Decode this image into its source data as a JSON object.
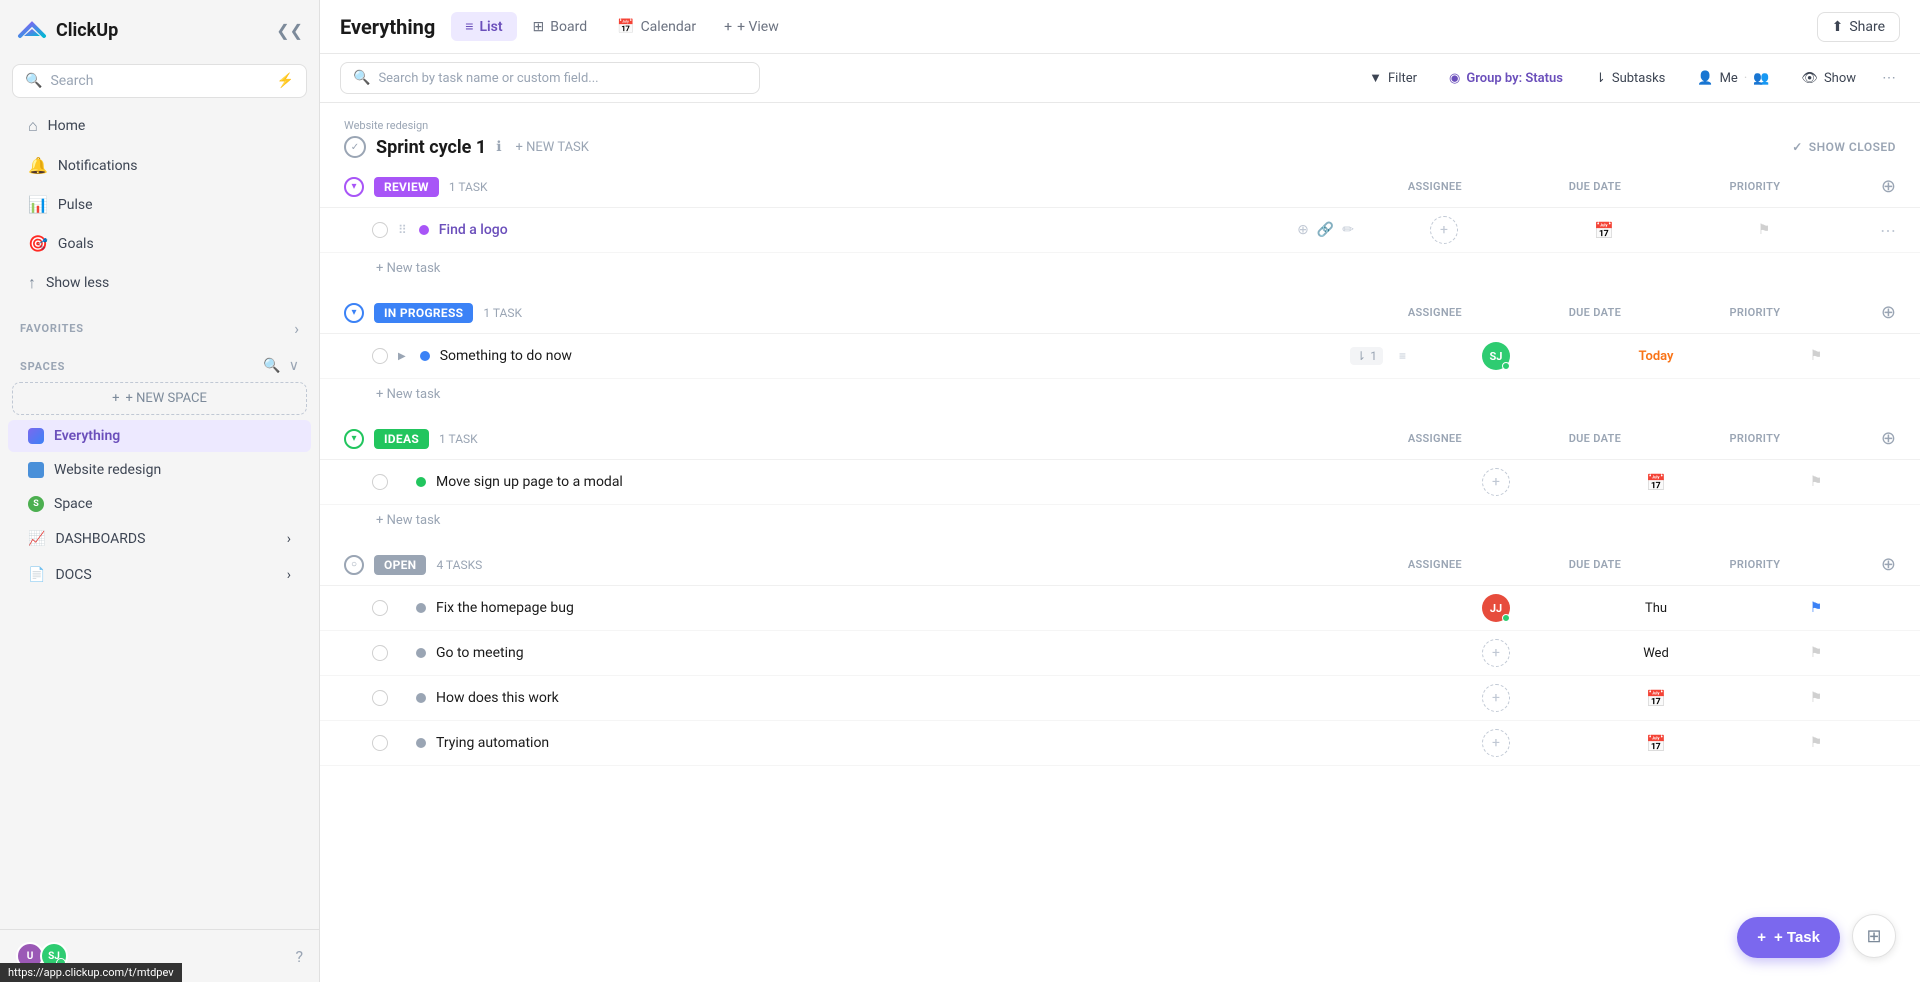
{
  "sidebar": {
    "logo_text": "ClickUp",
    "search_placeholder": "Search",
    "nav": [
      {
        "id": "home",
        "label": "Home",
        "icon": "⌂"
      },
      {
        "id": "notifications",
        "label": "Notifications",
        "icon": "🔔"
      },
      {
        "id": "pulse",
        "label": "Pulse",
        "icon": "📊"
      },
      {
        "id": "goals",
        "label": "Goals",
        "icon": "🎯"
      },
      {
        "id": "show_less",
        "label": "Show less",
        "icon": "↑"
      }
    ],
    "favorites_label": "FAVORITES",
    "spaces_label": "SPACES",
    "new_space_label": "+ NEW SPACE",
    "spaces": [
      {
        "id": "everything",
        "label": "Everything",
        "type": "all",
        "active": true
      },
      {
        "id": "website_redesign",
        "label": "Website redesign",
        "type": "board"
      },
      {
        "id": "space",
        "label": "Space",
        "type": "circle"
      }
    ],
    "dashboards_label": "DASHBOARDS",
    "docs_label": "DOCS",
    "user_initials_1": "U",
    "user_initials_2": "SJ"
  },
  "topbar": {
    "page_title": "Everything",
    "tabs": [
      {
        "id": "list",
        "label": "List",
        "icon": "≡",
        "active": true
      },
      {
        "id": "board",
        "label": "Board",
        "icon": "⊞"
      },
      {
        "id": "calendar",
        "label": "Calendar",
        "icon": "📅"
      }
    ],
    "add_view_label": "+ View",
    "share_label": "Share"
  },
  "toolbar": {
    "search_placeholder": "Search by task name or custom field...",
    "filter_label": "Filter",
    "group_by_label": "Group by: Status",
    "subtasks_label": "Subtasks",
    "me_label": "Me",
    "show_label": "Show"
  },
  "sprint": {
    "breadcrumb": "Website redesign",
    "name": "Sprint cycle 1",
    "new_task_label": "+ NEW TASK",
    "show_closed_label": "SHOW CLOSED"
  },
  "sections": [
    {
      "id": "review",
      "badge": "REVIEW",
      "count": "1 TASK",
      "cols": [
        "ASSIGNEE",
        "DUE DATE",
        "PRIORITY"
      ],
      "tasks": [
        {
          "id": "find_logo",
          "name": "Find a logo",
          "color": "purple",
          "assignee": null,
          "due_date": null,
          "priority": null,
          "has_actions": true
        }
      ]
    },
    {
      "id": "inprogress",
      "badge": "IN PROGRESS",
      "count": "1 TASK",
      "cols": [
        "ASSIGNEE",
        "DUE DATE",
        "PRIORITY"
      ],
      "tasks": [
        {
          "id": "something_todo",
          "name": "Something to do now",
          "color": "blue",
          "assignee": "SJ",
          "assignee_color": "#2ecc71",
          "due_date": "Today",
          "due_date_class": "today",
          "priority": null,
          "subtasks": "1",
          "has_expand": true
        }
      ]
    },
    {
      "id": "ideas",
      "badge": "IDEAS",
      "count": "1 TASK",
      "cols": [
        "ASSIGNEE",
        "DUE DATE",
        "PRIORITY"
      ],
      "tasks": [
        {
          "id": "move_signup",
          "name": "Move sign up page to a modal",
          "color": "green",
          "assignee": null,
          "due_date": null,
          "priority": null
        }
      ]
    },
    {
      "id": "open",
      "badge": "OPEN",
      "count": "4 TASKS",
      "cols": [
        "ASSIGNEE",
        "DUE DATE",
        "PRIORITY"
      ],
      "tasks": [
        {
          "id": "fix_homepage",
          "name": "Fix the homepage bug",
          "color": "gray",
          "assignee": "JJ",
          "assignee_color": "#e74c3c",
          "due_date": "Thu",
          "due_date_class": "thu",
          "priority": "set"
        },
        {
          "id": "go_meeting",
          "name": "Go to meeting",
          "color": "gray",
          "assignee": null,
          "due_date": "Wed",
          "due_date_class": "wed",
          "priority": null
        },
        {
          "id": "how_does",
          "name": "How does this work",
          "color": "gray",
          "assignee": null,
          "due_date": null,
          "priority": null
        },
        {
          "id": "trying_automation",
          "name": "Trying automation",
          "color": "gray",
          "assignee": null,
          "due_date": null,
          "priority": null
        }
      ]
    }
  ],
  "fab": {
    "label": "+ Task"
  },
  "url_tooltip": "https://app.clickup.com/t/mtdpev"
}
